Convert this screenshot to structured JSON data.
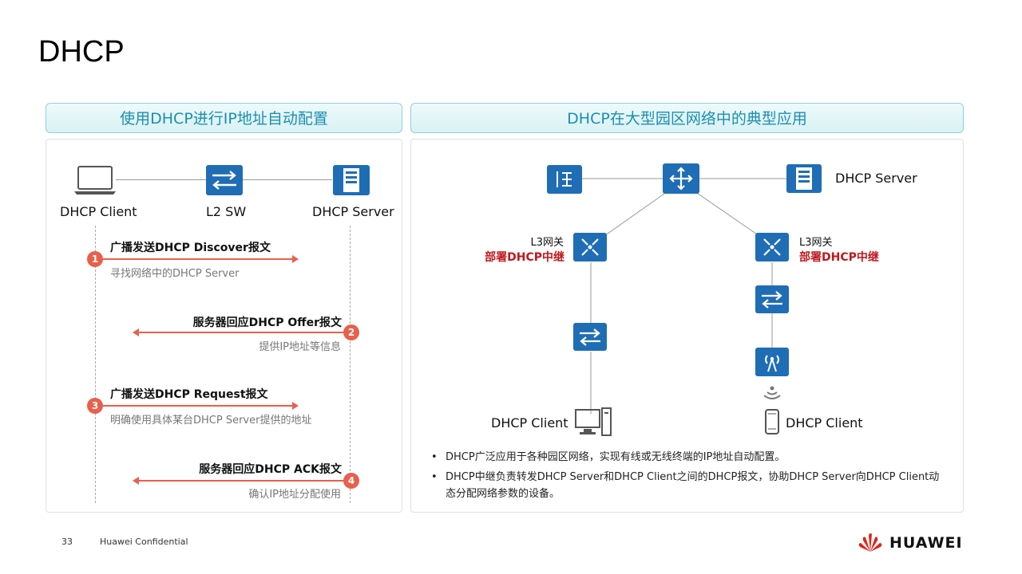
{
  "title": "DHCP",
  "left_panel": {
    "header": "使用DHCP进行IP地址自动配置",
    "devices": {
      "client": "DHCP Client",
      "switch": "L2 SW",
      "server": "DHCP Server"
    },
    "steps": [
      {
        "num": "1",
        "title": "广播发送DHCP Discover报文",
        "desc": "寻找网络中的DHCP Server"
      },
      {
        "num": "2",
        "title": "服务器回应DHCP Offer报文",
        "desc": "提供IP地址等信息"
      },
      {
        "num": "3",
        "title": "广播发送DHCP Request报文",
        "desc": "明确使用具体某台DHCP Server提供的地址"
      },
      {
        "num": "4",
        "title": "服务器回应DHCP ACK报文",
        "desc": "确认IP地址分配使用"
      }
    ]
  },
  "right_panel": {
    "header": "DHCP在大型园区网络中的典型应用",
    "server_label": "DHCP Server",
    "gw_left": {
      "label": "L3网关",
      "relay": "部署DHCP中继"
    },
    "gw_right": {
      "label": "L3网关",
      "relay": "部署DHCP中继"
    },
    "client_left": "DHCP Client",
    "client_right": "DHCP Client",
    "bullets": [
      "DHCP广泛应用于各种园区网络，实现有线或无线终端的IP地址自动配置。",
      "DHCP中继负责转发DHCP Server和DHCP  Client之间的DHCP报文，协助DHCP Server向DHCP Client动态分配网络参数的设备。"
    ]
  },
  "footer": {
    "page": "33",
    "confidential": "Huawei Confidential",
    "brand": "HUAWEI"
  },
  "colors": {
    "device_blue": "#1f6db5",
    "accent_red": "#e8604c",
    "relay_red": "#c0181c",
    "header_text": "#1a8fb2"
  }
}
